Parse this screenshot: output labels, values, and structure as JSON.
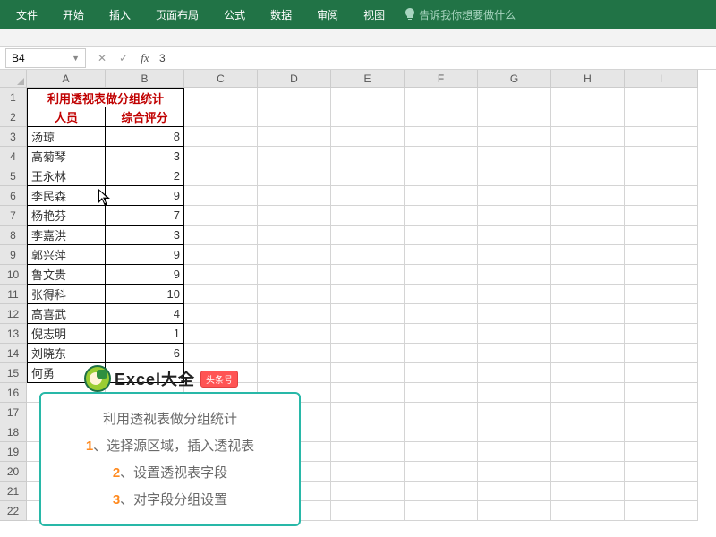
{
  "ribbon": {
    "tabs": [
      "文件",
      "开始",
      "插入",
      "页面布局",
      "公式",
      "数据",
      "审阅",
      "视图"
    ],
    "tellme": "告诉我你想要做什么"
  },
  "formula": {
    "namebox": "B4",
    "value": "3"
  },
  "cols": [
    "A",
    "B",
    "C",
    "D",
    "E",
    "F",
    "G",
    "H",
    "I"
  ],
  "rows": [
    "1",
    "2",
    "3",
    "4",
    "5",
    "6",
    "7",
    "8",
    "9",
    "10",
    "11",
    "12",
    "13",
    "14",
    "15",
    "16",
    "17",
    "18",
    "19",
    "20",
    "21",
    "22"
  ],
  "title": "利用透视表做分组统计",
  "headers": {
    "person": "人员",
    "score": "综合评分"
  },
  "data": [
    {
      "name": "汤琼",
      "score": "8"
    },
    {
      "name": "高菊琴",
      "score": "3"
    },
    {
      "name": "王永林",
      "score": "2"
    },
    {
      "name": "李民森",
      "score": "9"
    },
    {
      "name": "杨艳芬",
      "score": "7"
    },
    {
      "name": "李嘉洪",
      "score": "3"
    },
    {
      "name": "郭兴萍",
      "score": "9"
    },
    {
      "name": "鲁文贵",
      "score": "9"
    },
    {
      "name": "张得科",
      "score": "10"
    },
    {
      "name": "高喜武",
      "score": "4"
    },
    {
      "name": "倪志明",
      "score": "1"
    },
    {
      "name": "刘晓东",
      "score": "6"
    },
    {
      "name": "何勇",
      "score": ""
    }
  ],
  "brand": {
    "name": "Excel大全",
    "badge": "头条号"
  },
  "overlay": {
    "title": "利用透视表做分组统计",
    "steps": [
      {
        "n": "1",
        "t": "、选择源区域，插入透视表"
      },
      {
        "n": "2",
        "t": "、设置透视表字段"
      },
      {
        "n": "3",
        "t": "、对字段分组设置"
      }
    ]
  }
}
